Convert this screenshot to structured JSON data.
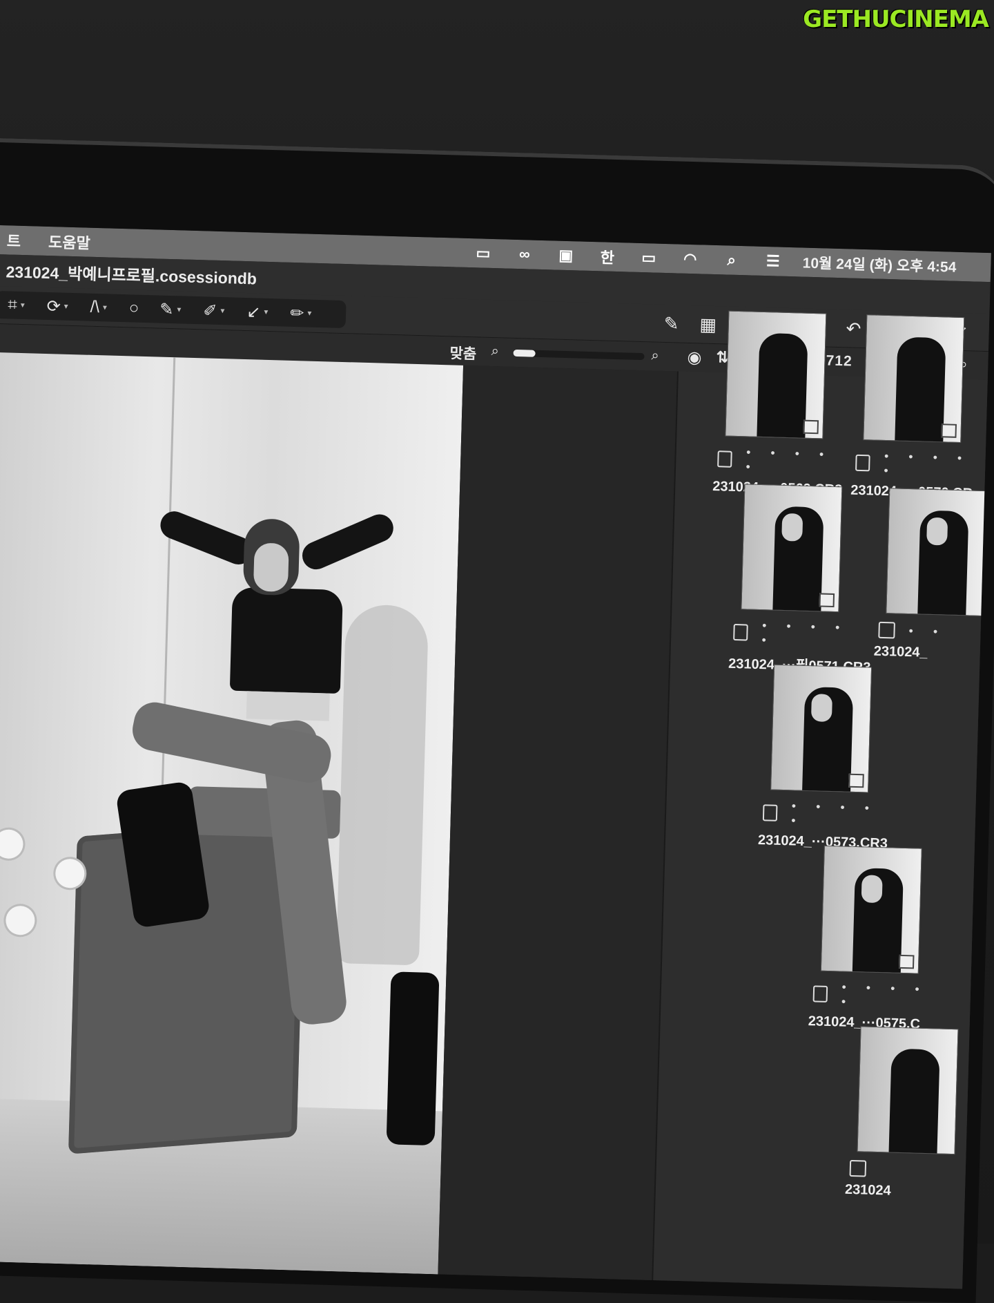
{
  "watermark": "GETHUCINEMA",
  "menubar": {
    "items": [
      "트",
      "도움말"
    ],
    "status_icons": [
      "display-icon",
      "creative-cloud-icon",
      "monitor-icon",
      "input-method-icon",
      "battery-icon",
      "wifi-icon",
      "search-icon",
      "control-center-icon"
    ],
    "input_method": "한",
    "clock": "10월 24일 (화) 오후 4:54"
  },
  "window": {
    "title": "231024_박예니프로필.cosessiondb"
  },
  "toolbar": {
    "left_tools": [
      "crop-icon",
      "rotate-icon",
      "keystone-icon",
      "ellipse-icon",
      "brush-icon",
      "eraser-icon",
      "pointer-icon",
      "picker-icon"
    ],
    "right_tools": [
      "edit-icon",
      "grid-icon",
      "warning-icon",
      "glasses-icon",
      "stack-icon",
      "undo-icon",
      "redo-icon",
      "expand-icon",
      "collapse-icon"
    ]
  },
  "viewer_bar": {
    "fit_label": "맞춤",
    "zoom_level": 0.17,
    "counter": "1 / 712"
  },
  "thumbnails": [
    {
      "name": "231024_···0569.CR3",
      "rating_dots": "• • • • •"
    },
    {
      "name": "231024_···0570.CR",
      "rating_dots": "• • • • •"
    },
    {
      "name": "231024_···필0571.CR3",
      "rating_dots": "• • • • •"
    },
    {
      "name": "231024_",
      "rating_dots": "• •"
    },
    {
      "name": "231024_···0573.CR3",
      "rating_dots": "• • • • •"
    },
    {
      "name": "231024_···0575.C",
      "rating_dots": "• • • • •"
    },
    {
      "name": "231024",
      "rating_dots": ""
    }
  ],
  "colors": {
    "menubar": "#6e6e6e",
    "toolbar": "#2e2e2e",
    "watermark": "#9be823"
  }
}
